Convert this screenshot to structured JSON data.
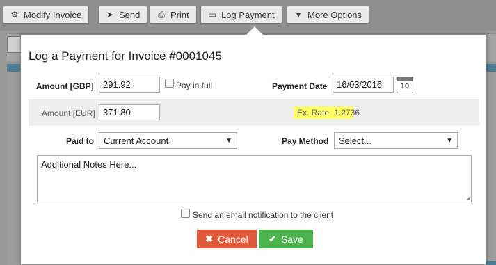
{
  "toolbar": {
    "modify": {
      "label": "Modify Invoice",
      "icon": "gear-icon"
    },
    "send": {
      "label": "Send",
      "icon": "send-icon"
    },
    "print": {
      "label": "Print",
      "icon": "print-icon"
    },
    "log_payment": {
      "label": "Log Payment",
      "icon": "credit-card-icon"
    },
    "more": {
      "label": "More Options",
      "icon": "caret-down-icon"
    }
  },
  "modal": {
    "title": "Log a Payment for Invoice #0001045",
    "amount_gbp": {
      "label": "Amount [GBP]",
      "value": "291.92"
    },
    "pay_in_full": {
      "label": "Pay in full",
      "checked": false
    },
    "payment_date": {
      "label": "Payment Date",
      "value": "16/03/2016",
      "calendar_day": "10"
    },
    "amount_eur": {
      "label": "Amount [EUR]",
      "value": "371.80"
    },
    "exchange_rate": {
      "label": "Ex. Rate",
      "value": "1.2736"
    },
    "paid_to": {
      "label": "Paid to",
      "selected": "Current Account"
    },
    "pay_method": {
      "label": "Pay Method",
      "selected": "Select..."
    },
    "notes": {
      "placeholder": "Additional Notes Here..."
    },
    "email_notification": {
      "label": "Send an email notification to the client",
      "checked": false
    },
    "cancel_button": {
      "label": "Cancel"
    },
    "save_button": {
      "label": "Save"
    }
  },
  "colors": {
    "cancel": "#e05a3b",
    "save": "#4db34d",
    "highlight": "#ffff66",
    "accent_bar": "#4c7d93"
  }
}
